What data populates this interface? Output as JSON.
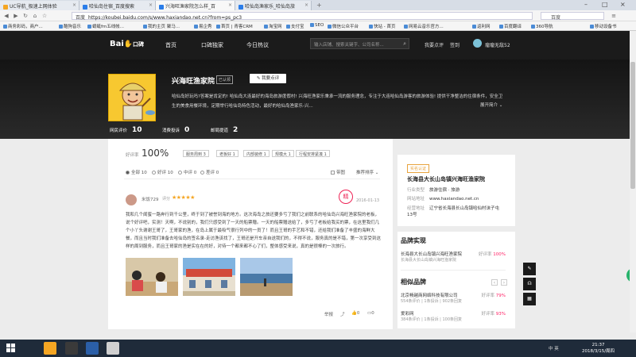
{
  "browser": {
    "tabs": [
      {
        "title": "UC导航_极速上网体验",
        "color": "#f5a623"
      },
      {
        "title": "哈仙岛住宿_百度搜索",
        "color": "#2b7de9"
      },
      {
        "title": "兴海旺渔家院怎么样_百",
        "color": "#2b7de9"
      },
      {
        "title": "哈仙岛渔家乐_哈仙岛旅",
        "color": "#2b7de9"
      }
    ],
    "url_site": "百度",
    "url": "https://koubei.baidu.com/s/www.haxiandao.net.cn?from=ps_pc3",
    "search_engine": "百度",
    "bookmarks": [
      "商务彩码，商户...",
      "酷狗音乐",
      "蜻蜓fm五线帐...",
      "我的主页 聚马...",
      "易企秀",
      "首页 | 青客CRM",
      "淘宝网",
      "支付宝",
      "SEO",
      "微信公众平台",
      "快站 - 首页",
      "网易云音乐官方...",
      "返利网",
      "百度翻译",
      "360导航",
      "移动设备书"
    ]
  },
  "site": {
    "logo_text": "Bai",
    "logo_suffix": "口碑",
    "nav": [
      "首页",
      "口碑独家",
      "今日热议"
    ],
    "search_placeholder": "输入店铺、搜索关键字、公司名称...",
    "header_links": [
      "我要点评",
      "签到"
    ],
    "username": "瘤瘤无敌52"
  },
  "shop": {
    "name": "兴海旺渔家院",
    "claimed_label": "已认领",
    "review_button": "我要点评",
    "description": "哈仙岛好玩吗?答案是肯定的! 哈仙岛大连最好的海岛旅游度假村! 兴海旺渔家乐秉承一流的服务理念，专注于大连哈仙岛游客的旅游体验! 提供干净整洁的住宿条件，安全卫生的美食用餐环境，定期举行哈仙岛特色活动，最好的哈仙岛渔家乐-兴...",
    "expand_label": "展开简介",
    "stats": [
      {
        "label": "网民评价",
        "value": "10"
      },
      {
        "label": "消费投诉",
        "value": "0"
      },
      {
        "label": "邮局提道",
        "value": "2"
      }
    ]
  },
  "reviews": {
    "score_label": "好评率",
    "score": "100%",
    "tags": [
      "服务周到 3",
      "老板好 1",
      "内部装修 1",
      "规模大 1",
      "行程安排紧凑 1"
    ],
    "filters": [
      "全部 10",
      "好评 10",
      "中评 0",
      "差评 0"
    ],
    "with_images": "带图",
    "sort": "推荐排序",
    "item": {
      "user": "米饭729",
      "score_prefix": "评分",
      "stars": "★★★★★",
      "stamp": "精",
      "date": "2016-01-13",
      "text": "我和几个闺蜜一路奔行到千公里，终于到了被誉到海的地方。这次海岛之旅还要多亏了我们之前联系的哈仙岛兴海旺渔家院的老板，说个好评吧，实测！天啊，不说别的，我们只感受到了一天的船票赠。一天的船票赠送给了，多亏了老板给我买的票，在这里我们几个小丫头谢谢王哥了，王哥家的渔，在岛上属于最吸气很行列中的一员了！而且王哥的手艺和不错，还给我们准备了丰盛的海鲜大餐，而且当时我们准备去哈仙岛的签名录-走访渔该找了，王哥还是开车亲自送我们的，不得不说，服务真的是不错，第一次享受到这样的周到服务，而且王哥家的渔是实在在的好，对待一个都来都不心了们，整体感受来说，真的是很棒的一次旅行。",
      "actions": {
        "report": "举报",
        "share": "分享",
        "likes": "0",
        "comments": "0"
      }
    }
  },
  "sidebar": {
    "verified_label": "实名认证",
    "company": "长海县大长山岛镇兴海旺渔家院",
    "rows": [
      {
        "label": "行业类型",
        "value": "旅游住宿 · 旅游"
      },
      {
        "label": "网站地址",
        "value": "www.haxiandao.net.cn"
      },
      {
        "label": "经营地址",
        "value": "辽宁省长海县长山岛镇哈仙村沫子屯13号"
      }
    ],
    "brand_title": "品牌实现",
    "brand_items": [
      {
        "name": "长海县大长山岛镇兴海旺渔家院",
        "sub": "长海县大长山岛镇兴海旺渔家院",
        "pct_label": "好评率",
        "pct": "100%"
      }
    ],
    "similar_title": "相似品牌",
    "similar_items": [
      {
        "name": "北京畅越商网络科技有限公司",
        "sub": "554条评价 | 1条投诉 | 902条回复",
        "pct_label": "好评率",
        "pct": "79%"
      },
      {
        "name": "爱彩网",
        "sub": "384条评价 | 1条投诉 | 100条回复",
        "pct_label": "好评率",
        "pct": "93%"
      }
    ]
  },
  "taskbar": {
    "tray": "中 英",
    "time": "21:37",
    "date": "2018/3/15/周四"
  }
}
